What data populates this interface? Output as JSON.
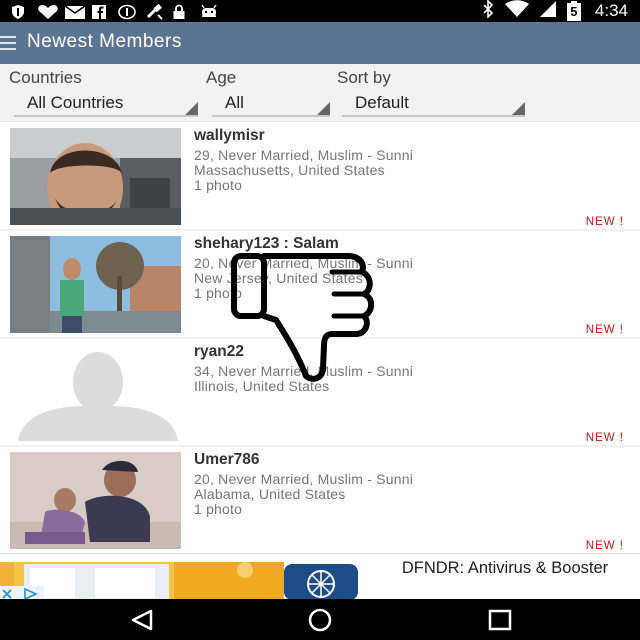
{
  "status_bar": {
    "time": "4:34",
    "left_icons": [
      "shield-icon",
      "heart-icon",
      "mail-icon",
      "facebook-icon",
      "notification-icon",
      "satellite-icon",
      "lock-icon",
      "android-icon"
    ],
    "right_icons": [
      "bluetooth-icon",
      "wifi-icon",
      "signal-icon",
      "battery-icon"
    ],
    "battery_level": "5"
  },
  "app_bar": {
    "title": "Newest Members"
  },
  "filters": {
    "countries": {
      "label": "Countries",
      "value": "All Countries"
    },
    "age": {
      "label": "Age",
      "value": "All"
    },
    "sort_by": {
      "label": "Sort by",
      "value": "Default"
    }
  },
  "members": [
    {
      "name": "wallymisr",
      "line1": "29, Never Married, Muslim - Sunni",
      "line2": "Massachusetts, United States",
      "line3": "1 photo",
      "badge": "NEW !"
    },
    {
      "name": "shehary123 : Salam",
      "line1": "20, Never Married, Muslim - Sunni",
      "line2": "New Jersey, United States",
      "line3": "1 photo",
      "badge": "NEW !"
    },
    {
      "name": "ryan22",
      "line1": "34, Never Married, Muslim - Sunni",
      "line2": "Illinois, United States",
      "line3": "",
      "badge": "NEW !"
    },
    {
      "name": "Umer786",
      "line1": "20, Never Married, Muslim - Sunni",
      "line2": "Alabama, United States",
      "line3": "1 photo",
      "badge": "NEW !"
    }
  ],
  "ad": {
    "title": "DFNDR: Antivirus & Booster"
  },
  "colors": {
    "app_bar": "#5a7491",
    "new_badge": "#d21414",
    "status_bar": "#000000"
  }
}
